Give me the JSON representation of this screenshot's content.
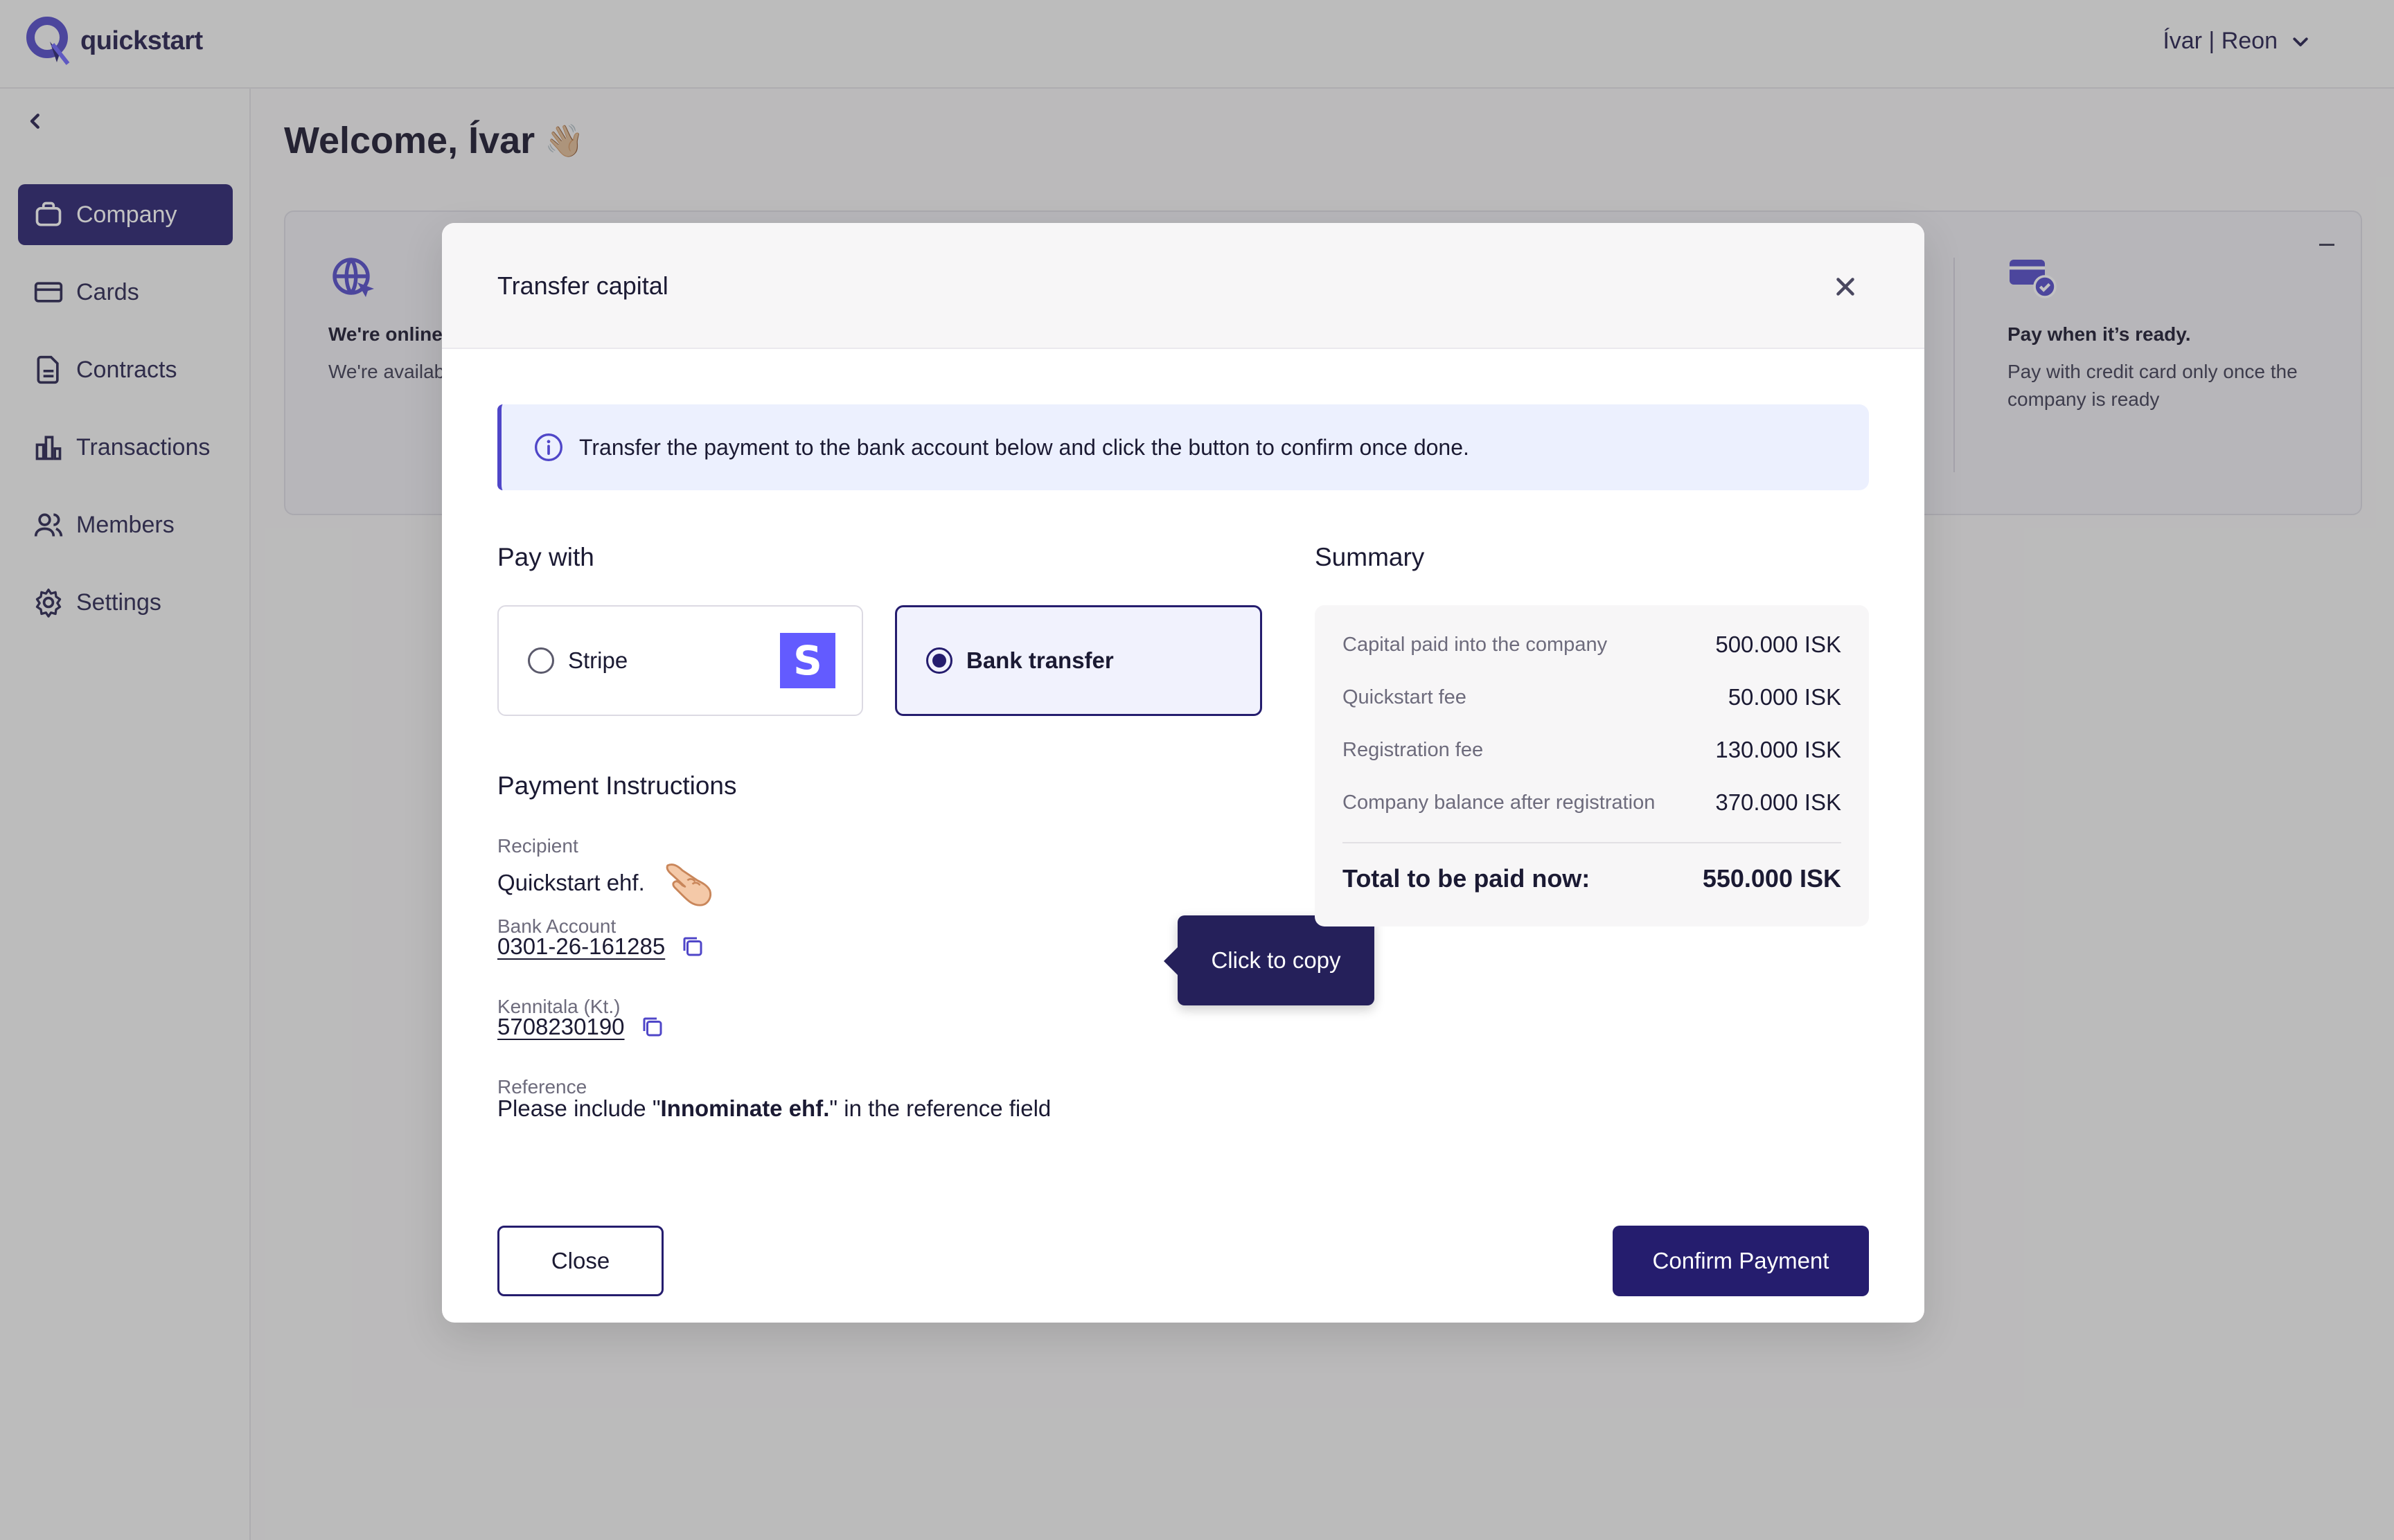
{
  "app": {
    "logo_text": "quickstart"
  },
  "header": {
    "user_label": "Ívar | Reon"
  },
  "sidebar": {
    "items": [
      {
        "label": "Company",
        "icon": "briefcase-icon",
        "active": true
      },
      {
        "label": "Cards",
        "icon": "credit-card-icon",
        "active": false
      },
      {
        "label": "Contracts",
        "icon": "document-icon",
        "active": false
      },
      {
        "label": "Transactions",
        "icon": "bar-chart-icon",
        "active": false
      },
      {
        "label": "Members",
        "icon": "users-icon",
        "active": false
      },
      {
        "label": "Settings",
        "icon": "gear-icon",
        "active": false
      }
    ]
  },
  "main": {
    "welcome": "Welcome, Ívar",
    "welcome_emoji": "👋🏼",
    "info_cards": [
      {
        "title": "We're online",
        "text": "We're available for your needs,"
      },
      {
        "title": "Pay when it’s ready.",
        "text": "Pay with credit card only once the company is ready"
      }
    ]
  },
  "modal": {
    "title": "Transfer capital",
    "alert_text": "Transfer the payment to the bank account below and click the button to confirm once done.",
    "pay_with_title": "Pay with",
    "pay_options": [
      {
        "label": "Stripe",
        "selected": false,
        "logo_letter": "S"
      },
      {
        "label": "Bank transfer",
        "selected": true
      }
    ],
    "instructions_title": "Payment Instructions",
    "recipient_label": "Recipient",
    "recipient_value": "Quickstart ehf.",
    "bank_account_label": "Bank Account",
    "bank_account_value": "0301-26-161285",
    "kennitala_label": "Kennitala (Kt.)",
    "kennitala_value": "5708230190",
    "reference_label": "Reference",
    "reference_prefix": "Please include \"",
    "reference_name": "Innominate ehf.",
    "reference_suffix": "\" in the reference field",
    "tooltip": "Click to copy",
    "summary_title": "Summary",
    "summary_rows": [
      {
        "label": "Capital paid into the company",
        "value": "500.000 ISK"
      },
      {
        "label": "Quickstart fee",
        "value": "50.000 ISK"
      },
      {
        "label": "Registration fee",
        "value": "130.000 ISK"
      },
      {
        "label": "Company balance after registration",
        "value": "370.000 ISK"
      }
    ],
    "total_label": "Total to be paid now:",
    "total_value": "550.000 ISK",
    "close_button": "Close",
    "confirm_button": "Confirm Payment"
  },
  "colors": {
    "primary": "#251d6e",
    "accent": "#4f46c8",
    "stripe": "#635bff",
    "alert_bg": "#ecf0fe"
  }
}
